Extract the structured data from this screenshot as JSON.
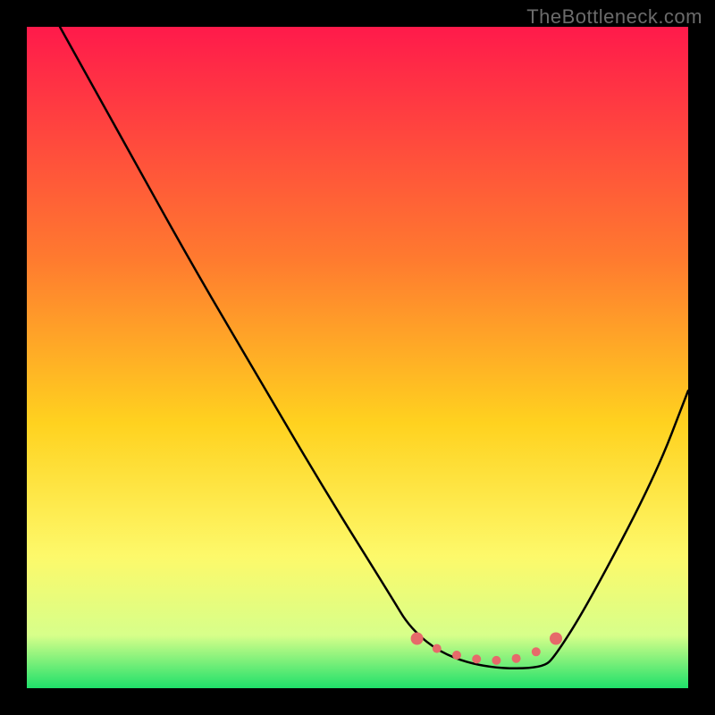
{
  "watermark": "TheBottleneck.com",
  "chart_data": {
    "type": "line",
    "title": "",
    "xlabel": "",
    "ylabel": "",
    "xlim": [
      0,
      100
    ],
    "ylim": [
      0,
      100
    ],
    "grid": false,
    "legend": false,
    "series": [
      {
        "name": "bottleneck-curve",
        "style": "black-line",
        "x": [
          5,
          15,
          25,
          35,
          45,
          55,
          58,
          63,
          70,
          78,
          80,
          85,
          95,
          100
        ],
        "values": [
          100,
          82,
          64,
          47,
          30,
          14,
          9,
          5,
          3,
          3,
          5,
          13,
          32,
          45
        ]
      },
      {
        "name": "optimal-band",
        "style": "red-dotted",
        "x": [
          59,
          62,
          65,
          68,
          71,
          74,
          77,
          80
        ],
        "values": [
          7.5,
          6.0,
          5.0,
          4.4,
          4.2,
          4.5,
          5.5,
          7.5
        ]
      }
    ],
    "gradient_colors": {
      "top": "#ff1a4b",
      "mid_upper": "#ff7a2f",
      "mid": "#ffd21f",
      "mid_lower": "#fdf96a",
      "band_light": "#d7ff8a",
      "bottom": "#1fe06a"
    }
  }
}
